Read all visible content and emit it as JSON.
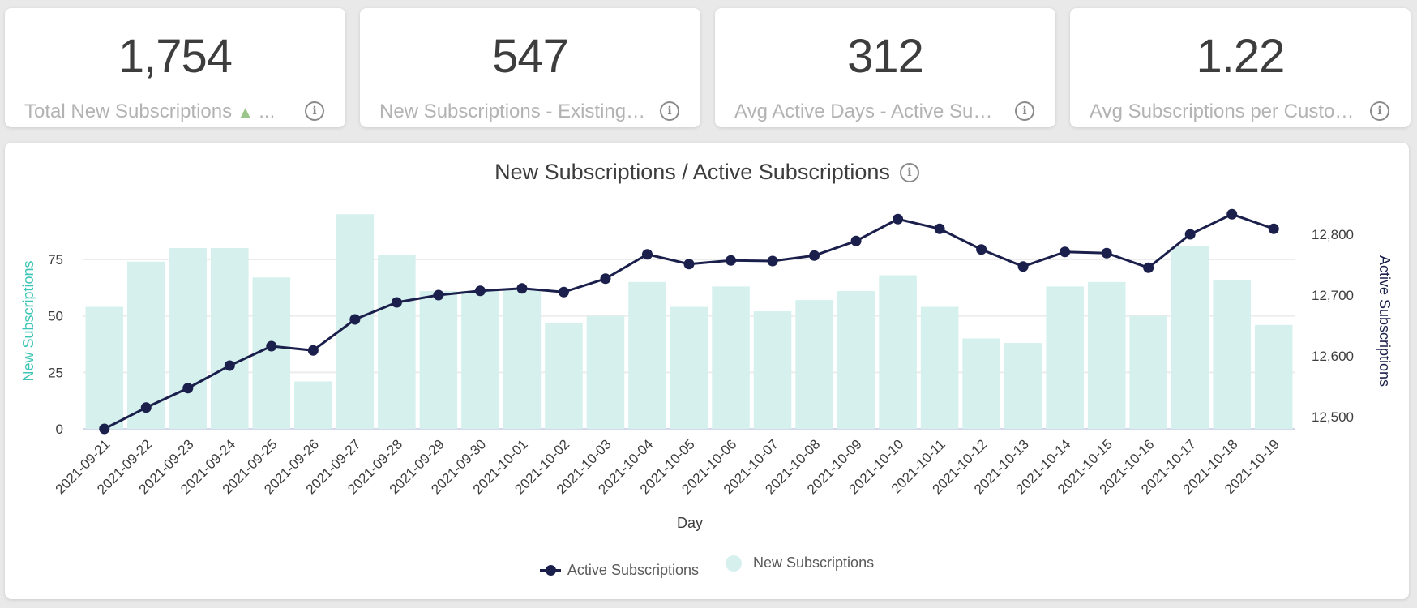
{
  "kpis": [
    {
      "value": "1,754",
      "label": "Total New Subscriptions",
      "trend": "▲",
      "truncated": "..."
    },
    {
      "value": "547",
      "label": "New Subscriptions - Existing Customers"
    },
    {
      "value": "312",
      "label": "Avg Active Days - Active Subscriptions"
    },
    {
      "value": "1.22",
      "label": "Avg Subscriptions per Customer"
    }
  ],
  "info_glyph": "i",
  "chart": {
    "title": "New Subscriptions / Active Subscriptions",
    "legend": {
      "line": "Active Subscriptions",
      "bar": "New Subscriptions"
    }
  },
  "colors": {
    "bar": "#d5f0ed",
    "line": "#1b1f4b",
    "left_axis_label": "#3cc4b4",
    "right_axis_label": "#1b1f4b"
  },
  "chart_data": {
    "type": "bar+line",
    "title": "New Subscriptions / Active Subscriptions",
    "xlabel": "Day",
    "ylabel": "New Subscriptions",
    "y2label": "Active Subscriptions",
    "categories": [
      "2021-09-21",
      "2021-09-22",
      "2021-09-23",
      "2021-09-24",
      "2021-09-25",
      "2021-09-26",
      "2021-09-27",
      "2021-09-28",
      "2021-09-29",
      "2021-09-30",
      "2021-10-01",
      "2021-10-02",
      "2021-10-03",
      "2021-10-04",
      "2021-10-05",
      "2021-10-06",
      "2021-10-07",
      "2021-10-08",
      "2021-10-09",
      "2021-10-10",
      "2021-10-11",
      "2021-10-12",
      "2021-10-13",
      "2021-10-14",
      "2021-10-15",
      "2021-10-16",
      "2021-10-17",
      "2021-10-18",
      "2021-10-19"
    ],
    "series": [
      {
        "name": "New Subscriptions",
        "type": "bar",
        "axis": "left",
        "values": [
          54,
          74,
          80,
          80,
          67,
          21,
          95,
          77,
          61,
          61,
          62,
          47,
          50,
          65,
          54,
          63,
          52,
          57,
          61,
          68,
          54,
          40,
          38,
          63,
          65,
          50,
          81,
          66,
          46
        ]
      },
      {
        "name": "Active Subscriptions",
        "type": "line",
        "axis": "right",
        "values": [
          12480,
          12515,
          12547,
          12584,
          12616,
          12609,
          12660,
          12688,
          12700,
          12707,
          12711,
          12705,
          12727,
          12767,
          12751,
          12757,
          12756,
          12765,
          12789,
          12825,
          12809,
          12775,
          12747,
          12771,
          12769,
          12745,
          12800,
          12833,
          12809
        ]
      }
    ],
    "yticks": [
      0,
      25,
      50,
      75
    ],
    "ylim": [
      0,
      100
    ],
    "y2ticks": [
      12500,
      12600,
      12700,
      12800
    ],
    "y2ticklabels": [
      "12,500",
      "12,600",
      "12,700",
      "12,800"
    ],
    "y2lim": [
      12480,
      12800
    ],
    "grid": true,
    "legend_position": "bottom"
  }
}
